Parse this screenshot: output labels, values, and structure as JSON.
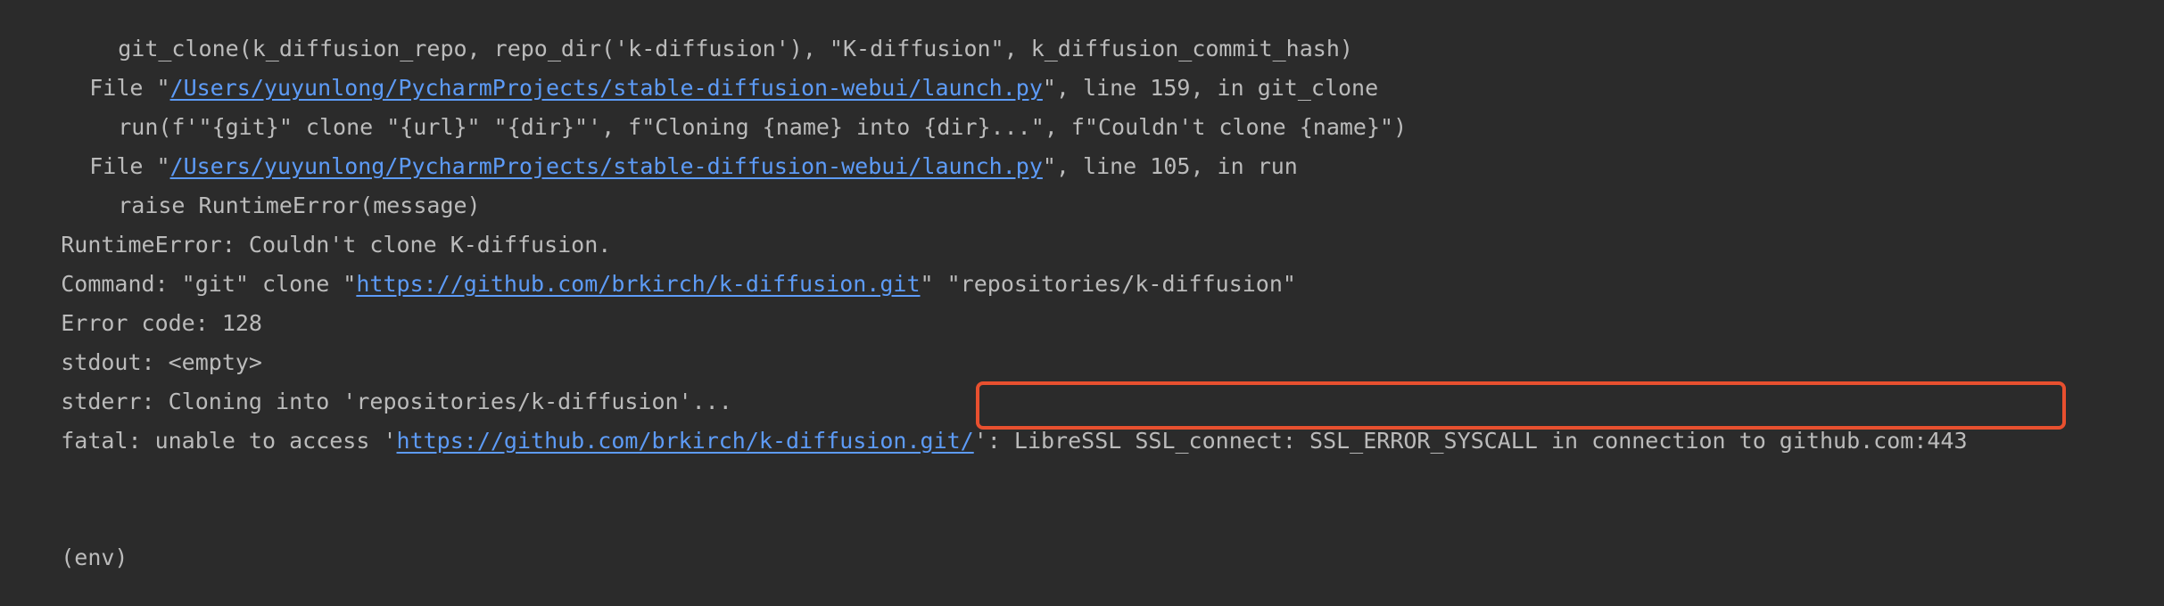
{
  "terminal": {
    "line1": {
      "text": "git_clone(k_diffusion_repo, repo_dir('k-diffusion'), \"K-diffusion\", k_diffusion_commit_hash)"
    },
    "line2": {
      "prefix": "File \"",
      "path": "/Users/yuyunlong/PycharmProjects/stable-diffusion-webui/launch.py",
      "suffix": "\", line 159, in git_clone"
    },
    "line3": {
      "text": "run(f'\"{git}\" clone \"{url}\" \"{dir}\"', f\"Cloning {name} into {dir}...\", f\"Couldn't clone {name}\")"
    },
    "line4": {
      "prefix": "File \"",
      "path": "/Users/yuyunlong/PycharmProjects/stable-diffusion-webui/launch.py",
      "suffix": "\", line 105, in run"
    },
    "line5": {
      "text": "raise RuntimeError(message)"
    },
    "line6": {
      "text": "RuntimeError: Couldn't clone K-diffusion."
    },
    "line7": {
      "prefix": "Command: \"git\" clone \"",
      "url": "https://github.com/brkirch/k-diffusion.git",
      "suffix": "\" \"repositories/k-diffusion\""
    },
    "line8": {
      "text": "Error code: 128"
    },
    "line9": {
      "text": "stdout: <empty>"
    },
    "line10": {
      "text": "stderr: Cloning into 'repositories/k-diffusion'..."
    },
    "line11": {
      "prefix": "fatal: unable to access '",
      "url": "https://github.com/brkirch/k-diffusion.git/",
      "suffix": "': LibreSSL SSL_connect: SSL_ERROR_SYSCALL in connection to github.com:443"
    },
    "prompt": {
      "text": "(env)"
    }
  },
  "colors": {
    "background": "#2b2b2b",
    "text": "#bbbbbb",
    "link": "#5d9bf7",
    "highlight": "#e8502f"
  }
}
